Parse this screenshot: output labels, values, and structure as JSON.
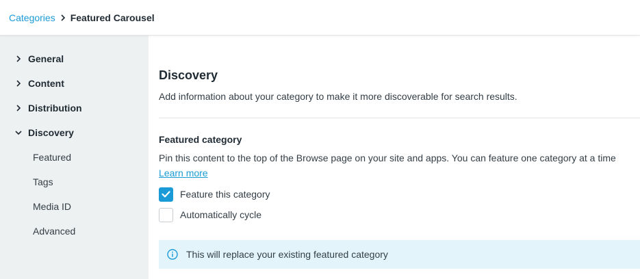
{
  "breadcrumb": {
    "parent": "Categories",
    "current": "Featured Carousel"
  },
  "sidebar": {
    "items": [
      {
        "label": "General",
        "expanded": false
      },
      {
        "label": "Content",
        "expanded": false
      },
      {
        "label": "Distribution",
        "expanded": false
      },
      {
        "label": "Discovery",
        "expanded": true
      }
    ],
    "sub_items": [
      {
        "label": "Featured"
      },
      {
        "label": "Tags"
      },
      {
        "label": "Media ID"
      },
      {
        "label": "Advanced"
      }
    ]
  },
  "main": {
    "title": "Discovery",
    "description": "Add information about your category to make it more discoverable for search results.",
    "featured": {
      "title": "Featured category",
      "description": "Pin this content to the top of the Browse page on your site and apps. You can feature one category at a time",
      "learn_more": "Learn more",
      "options": [
        {
          "label": "Feature this category",
          "checked": true
        },
        {
          "label": "Automatically cycle",
          "checked": false
        }
      ]
    },
    "info_banner": "This will replace your existing featured category"
  },
  "colors": {
    "accent": "#1a9bd7",
    "sidebar_bg": "#eef1f2",
    "banner_bg": "#e3f5fb"
  },
  "icons": {
    "breadcrumb_separator": "chevron-right-icon",
    "collapsed": "chevron-right-icon",
    "expanded": "chevron-down-icon",
    "check": "check-icon",
    "info": "info-icon"
  }
}
